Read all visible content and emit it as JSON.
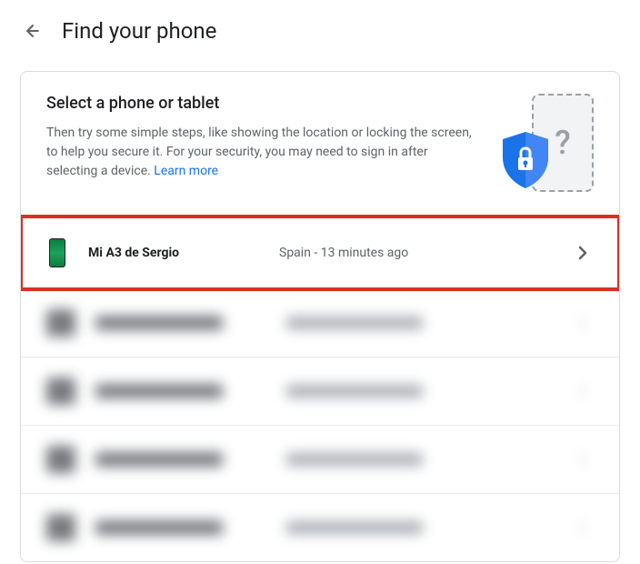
{
  "header": {
    "title": "Find your phone"
  },
  "card": {
    "title": "Select a phone or tablet",
    "description": "Then try some simple steps, like showing the location or locking the screen, to help you secure it. For your security, you may need to sign in after selecting a device. ",
    "learn_more": "Learn more"
  },
  "devices": [
    {
      "name": "Mi A3 de Sergio",
      "location": "Spain",
      "time": "13 minutes ago",
      "highlighted": true
    }
  ]
}
